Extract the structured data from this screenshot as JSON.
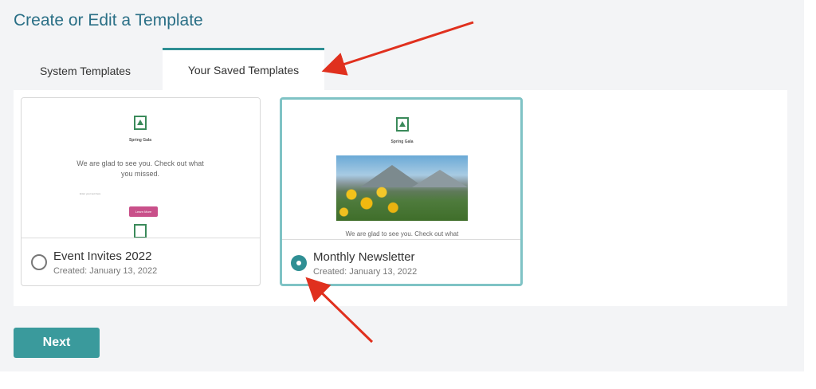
{
  "page": {
    "title": "Create or Edit a Template"
  },
  "tabs": [
    {
      "label": "System Templates",
      "active": false
    },
    {
      "label": "Your Saved Templates",
      "active": true
    }
  ],
  "templates": [
    {
      "name": "Event Invites 2022",
      "created": "Created: January 13, 2022",
      "selected": false,
      "preview": {
        "event_name": "Spring Gala",
        "body_text": "We are glad to see you. Check out what you missed.",
        "small_text": "Enter your text here",
        "button_label": "Learn More"
      }
    },
    {
      "name": "Monthly Newsletter",
      "created": "Created: January 13, 2022",
      "selected": true,
      "preview": {
        "event_name": "Spring Gala",
        "body_text": "We are glad to see you. Check out what"
      }
    }
  ],
  "actions": {
    "next_label": "Next"
  },
  "colors": {
    "accent": "#2f8f94",
    "title": "#2a6f86",
    "button": "#3a9a9c",
    "annotation_arrow": "#e0301e"
  },
  "icons": [
    "radio-unchecked-icon",
    "radio-checked-icon",
    "logo-icon",
    "annotation-arrow-icon"
  ]
}
